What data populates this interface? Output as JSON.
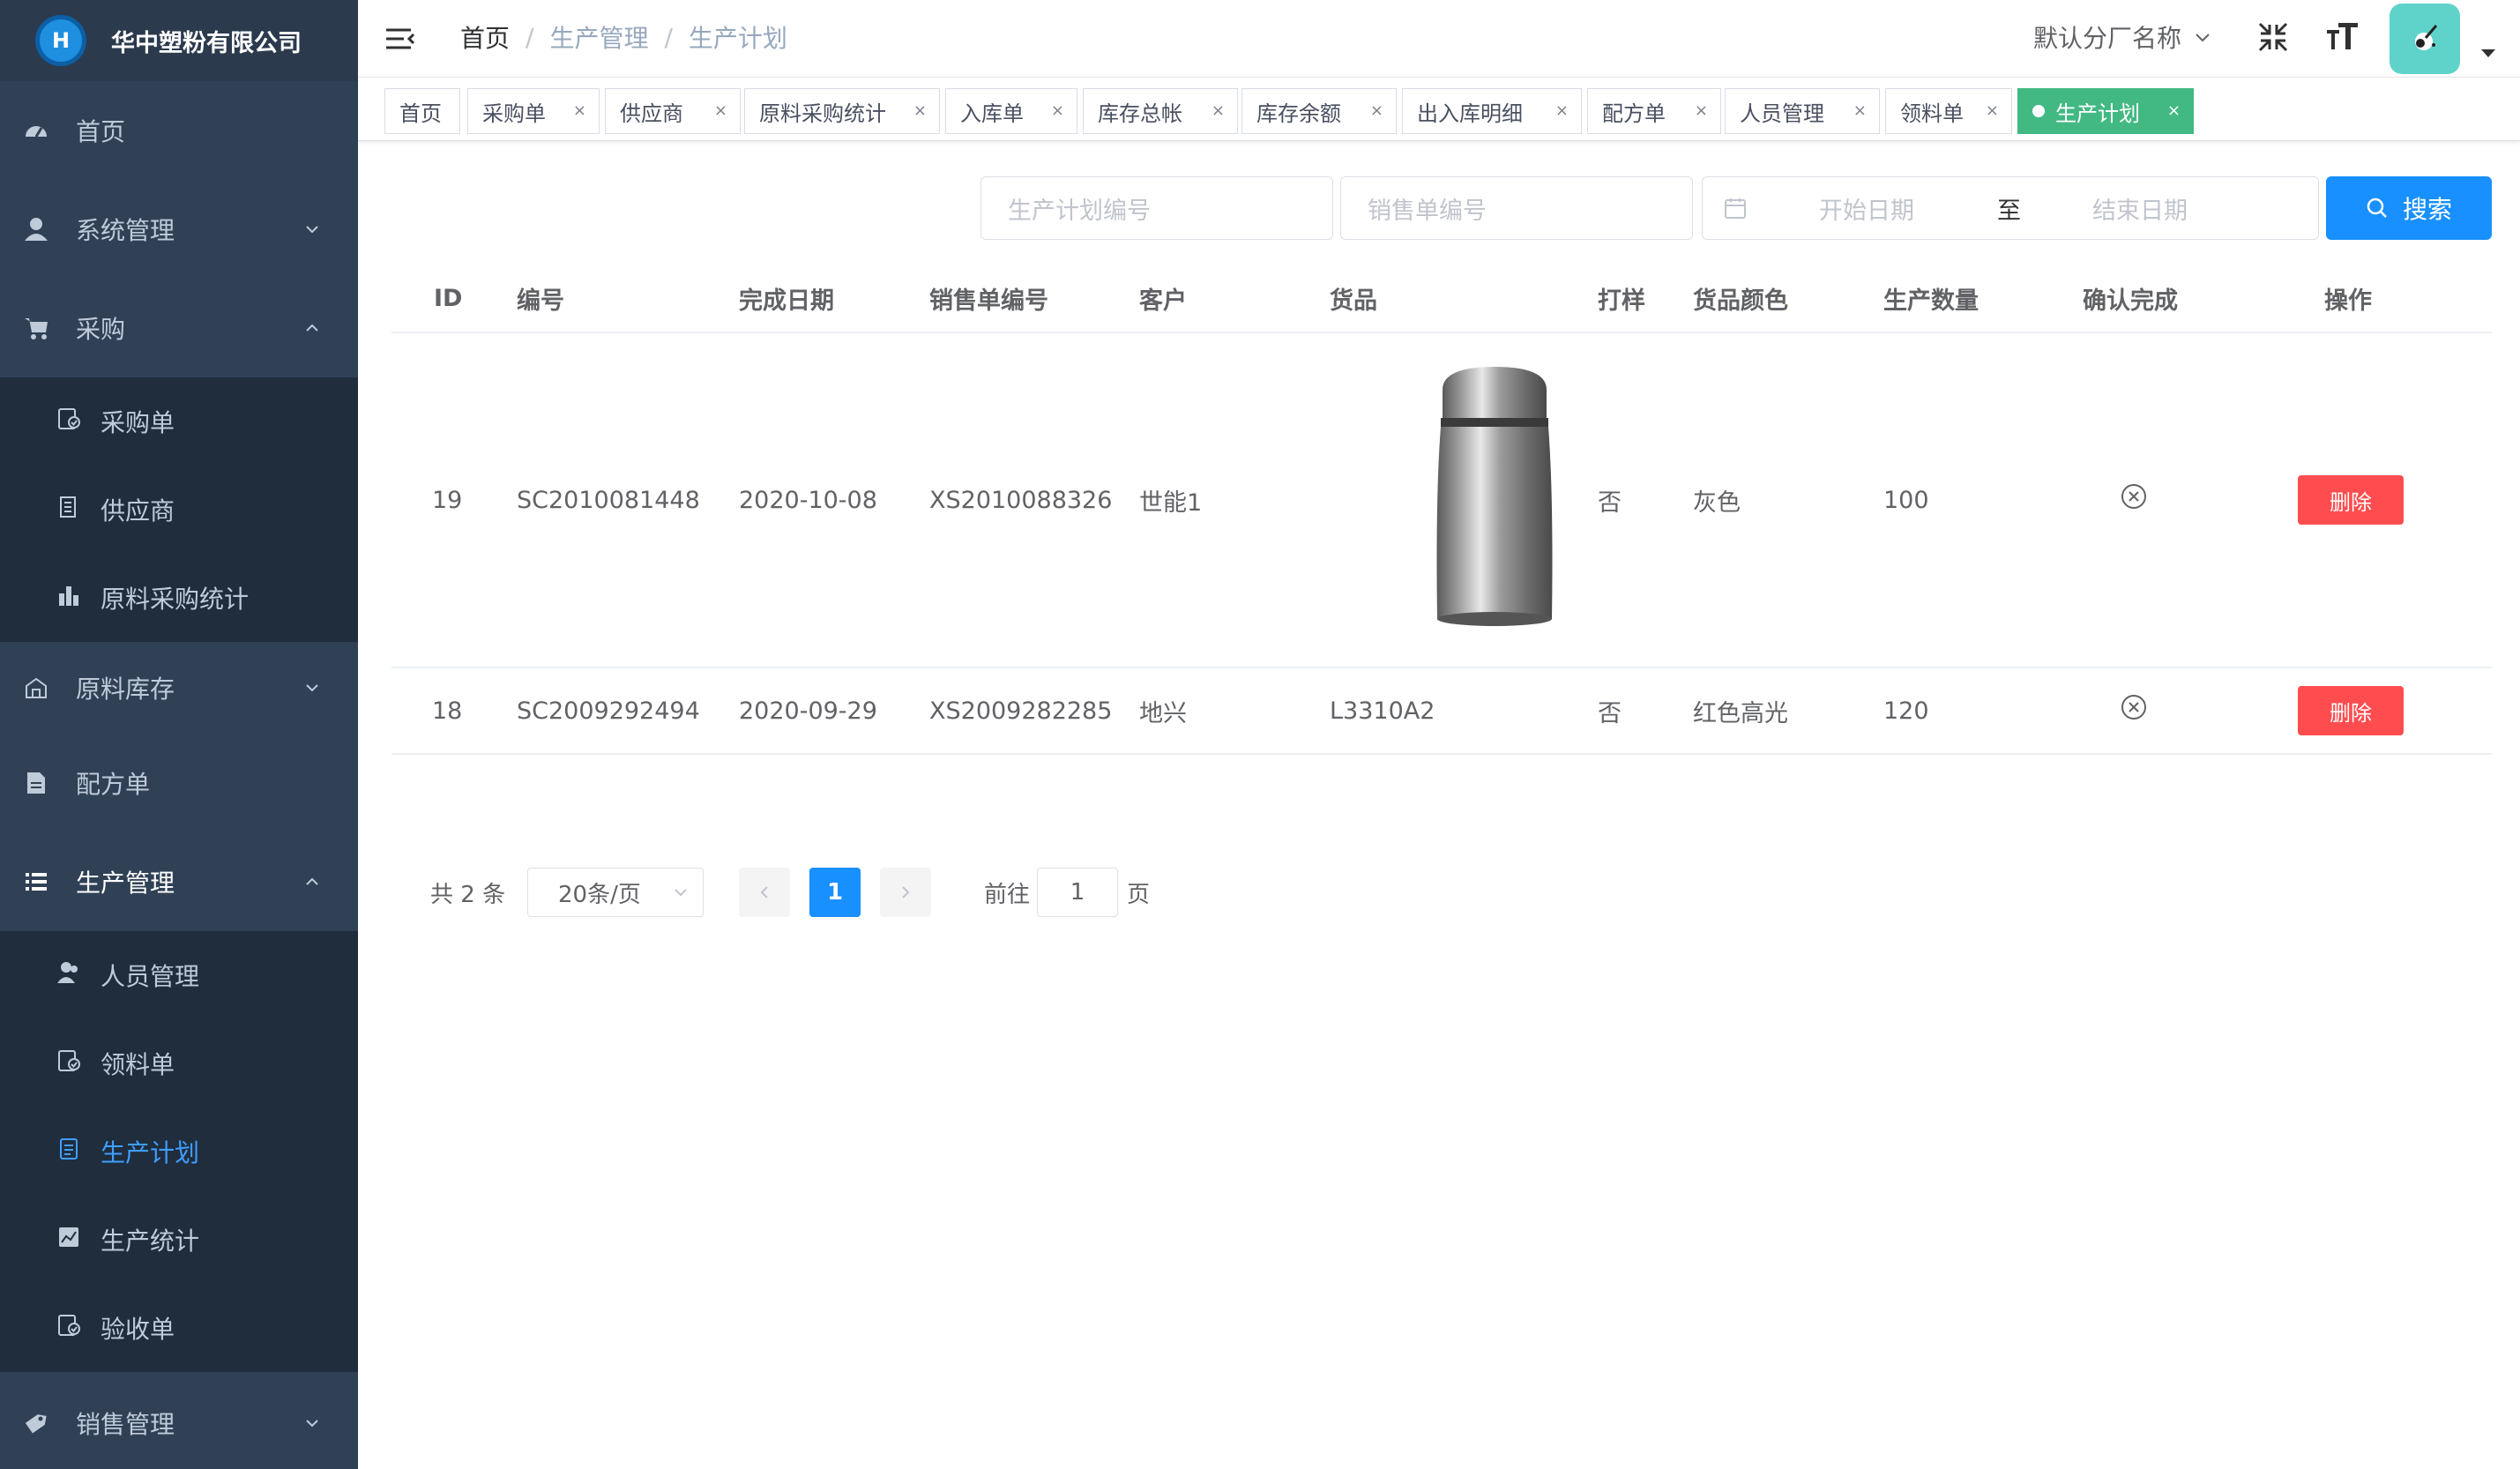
{
  "app": {
    "company": "华中塑粉有限公司",
    "logo_letter": "H"
  },
  "sidebar": {
    "items": [
      {
        "label": "首页"
      },
      {
        "label": "系统管理"
      },
      {
        "label": "采购"
      },
      {
        "label": "原料库存"
      },
      {
        "label": "配方单"
      },
      {
        "label": "生产管理"
      },
      {
        "label": "销售管理"
      }
    ],
    "purchase_sub": [
      {
        "label": "采购单"
      },
      {
        "label": "供应商"
      },
      {
        "label": "原料采购统计"
      }
    ],
    "production_sub": [
      {
        "label": "人员管理"
      },
      {
        "label": "领料单"
      },
      {
        "label": "生产计划"
      },
      {
        "label": "生产统计"
      },
      {
        "label": "验收单"
      }
    ]
  },
  "navbar": {
    "breadcrumb": [
      "首页",
      "生产管理",
      "生产计划"
    ],
    "factory_label": "默认分厂名称"
  },
  "tags": [
    "首页",
    "采购单",
    "供应商",
    "原料采购统计",
    "入库单",
    "库存总帐",
    "库存余额",
    "出入库明细",
    "配方单",
    "人员管理",
    "领料单",
    "生产计划"
  ],
  "search": {
    "plan_no_placeholder": "生产计划编号",
    "sales_no_placeholder": "销售单编号",
    "start_date_placeholder": "开始日期",
    "range_separator": "至",
    "end_date_placeholder": "结束日期",
    "button_label": "搜索"
  },
  "table": {
    "columns": [
      "ID",
      "编号",
      "完成日期",
      "销售单编号",
      "客户",
      "货品",
      "打样",
      "货品颜色",
      "生产数量",
      "确认完成",
      "操作"
    ],
    "rows": [
      {
        "id": "19",
        "code": "SC2010081448",
        "date": "2020-10-08",
        "sales_no": "XS2010088326",
        "customer": "世能1",
        "product": "",
        "product_image": "steel-vacuum-flask",
        "sample": "否",
        "color": "灰色",
        "qty": "100",
        "confirmed": "x-circle-icon",
        "action": "删除"
      },
      {
        "id": "18",
        "code": "SC2009292494",
        "date": "2020-09-29",
        "sales_no": "XS2009282285",
        "customer": "地兴",
        "product": "L3310A2",
        "sample": "否",
        "color": "红色高光",
        "qty": "120",
        "confirmed": "x-circle-icon",
        "action": "删除"
      }
    ]
  },
  "pagination": {
    "total_text": "共 2 条",
    "page_size": "20条/页",
    "current_page": "1",
    "goto_label": "前往",
    "goto_value": "1",
    "page_suffix": "页"
  },
  "colors": {
    "sidebar_bg": "#304156",
    "submenu_bg": "#1f2d3d",
    "active_menu": "#409eff",
    "active_tag": "#42b983",
    "primary": "#1890ff",
    "danger": "#ff4d4f"
  }
}
